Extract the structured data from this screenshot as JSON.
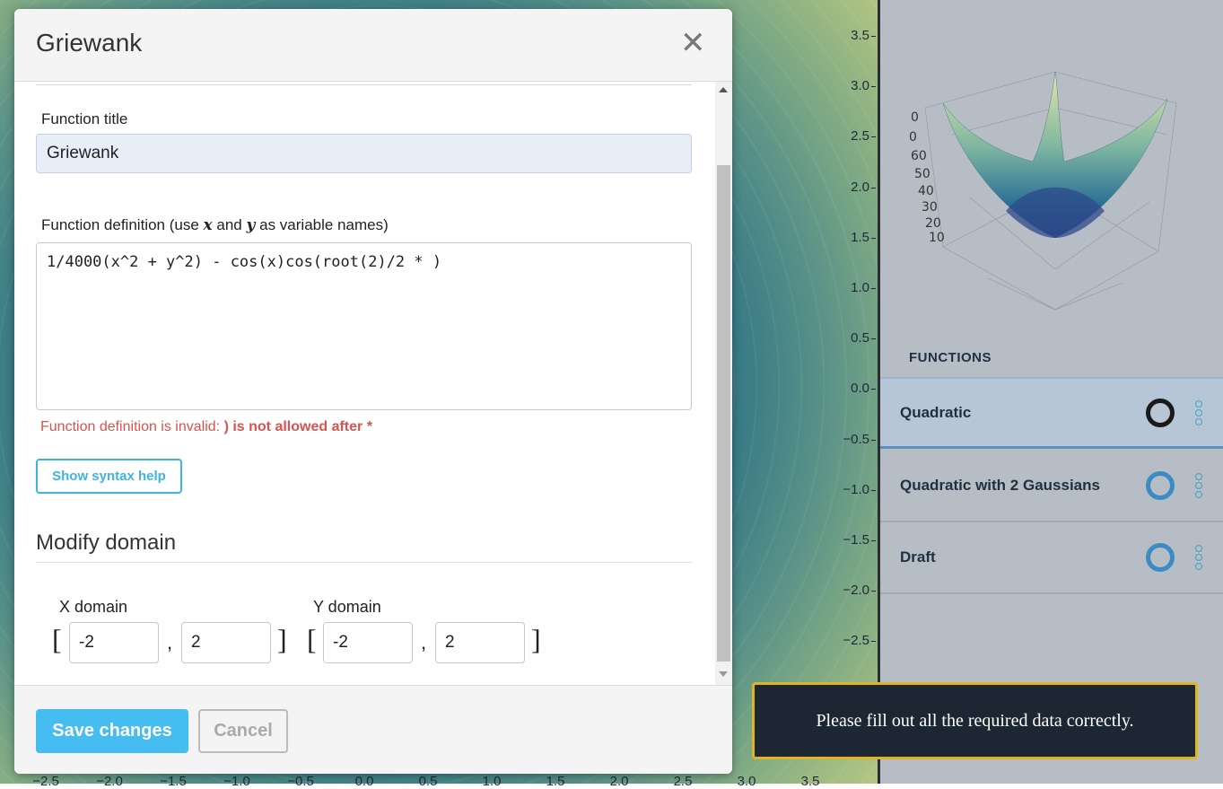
{
  "modal": {
    "title": "Griewank",
    "close_glyph": "✕",
    "function_title_label": "Function title",
    "function_title_value": "Griewank",
    "definition_label_pre": "Function definition (use",
    "definition_var_x": "x",
    "definition_label_mid": "and",
    "definition_var_y": "y",
    "definition_label_post": "as variable names)",
    "definition_value": "1/4000(x^2 + y^2) - cos(x)cos(root(2)/2 * )",
    "error_prefix": "Function definition is invalid:",
    "error_detail": ") is not allowed after *",
    "syntax_help_button": "Show syntax help",
    "domain_heading": "Modify domain",
    "x_domain_label": "X domain",
    "y_domain_label": "Y domain",
    "x_domain_min": "-2",
    "x_domain_max": "2",
    "y_domain_min": "-2",
    "y_domain_max": "2",
    "bracket_open": "[",
    "bracket_close": "]",
    "comma": ",",
    "save_button": "Save changes",
    "cancel_button": "Cancel"
  },
  "background_plot": {
    "y_ticks": [
      "3.5",
      "3.0",
      "2.5",
      "2.0",
      "1.5",
      "1.0",
      "0.5",
      "0.0",
      "−0.5",
      "−1.0",
      "−1.5",
      "−2.0",
      "−2.5"
    ],
    "x_ticks_bottom": [
      "−2.5",
      "−2.0",
      "−1.5",
      "−1.0",
      "−0.5",
      "0.0",
      "0.5",
      "1.0",
      "1.5",
      "2.0",
      "2.5",
      "3.0",
      "3.5"
    ]
  },
  "sidebar": {
    "functions_heading": "FUNCTIONS",
    "items": [
      {
        "label": "Quadratic",
        "active": true,
        "ring_color": "#1a1a1a"
      },
      {
        "label": "Quadratic with 2 Gaussians",
        "active": false,
        "ring_color": "#3b8cc4"
      },
      {
        "label": "Draft",
        "active": false,
        "ring_color": "#3b8cc4"
      }
    ]
  },
  "toast": {
    "message": "Please fill out all the required data correctly."
  },
  "colors": {
    "accent": "#46bdf0",
    "error": "#d9534f",
    "toast_border": "#e0b321",
    "toast_bg": "#1d2733"
  }
}
